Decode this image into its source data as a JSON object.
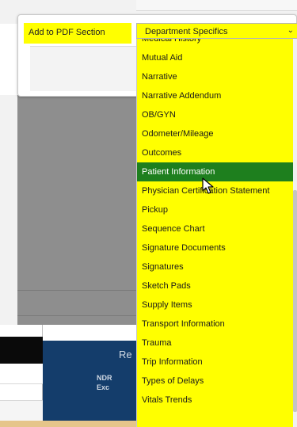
{
  "form": {
    "label": "Add to PDF Section",
    "select_value": "Department Specifics",
    "chevron_icon": "chevron-down-icon"
  },
  "dropdown": {
    "items": [
      "Medical History",
      "Mutual Aid",
      "Narrative",
      "Narrative Addendum",
      "OB/GYN",
      "Odometer/Mileage",
      "Outcomes",
      "Patient Information",
      "Physician Certification Statement",
      "Pickup",
      "Sequence Chart",
      "Signature Documents",
      "Signatures",
      "Sketch Pads",
      "Supply Items",
      "Transport Information",
      "Trauma",
      "Trip Information",
      "Types of Delays",
      "Vitals Trends"
    ],
    "selected": "Patient Information",
    "highlight_color": "#1e7f1e",
    "background_color": "#ffff00"
  },
  "banner": {
    "title": "Re",
    "line1": "NDR",
    "line2": "Exc"
  },
  "cursor_icon": "mouse-pointer-icon"
}
